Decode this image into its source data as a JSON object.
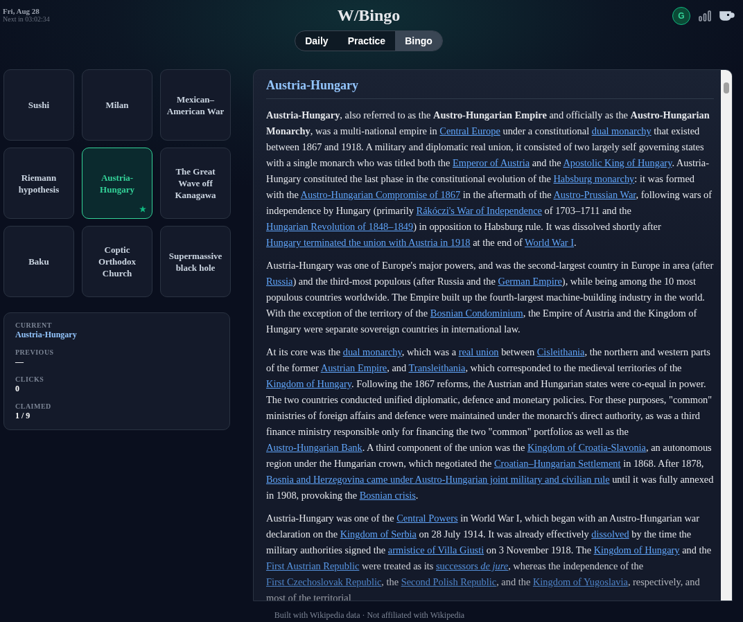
{
  "header": {
    "date": "Fri, Aug 28",
    "countdown": "Next in 03:02:34",
    "title": "W/Bingo",
    "avatar": "G"
  },
  "tabs": [
    {
      "label": "Daily",
      "selected": false
    },
    {
      "label": "Practice",
      "selected": false
    },
    {
      "label": "Bingo",
      "selected": true
    }
  ],
  "tiles": [
    {
      "label": "Sushi",
      "selected": false,
      "claimed": false
    },
    {
      "label": "Milan",
      "selected": false,
      "claimed": false
    },
    {
      "label": "Mexican–American War",
      "selected": false,
      "claimed": false
    },
    {
      "label": "Riemann hypothesis",
      "selected": false,
      "claimed": false
    },
    {
      "label": "Austria-Hungary",
      "selected": true,
      "claimed": true
    },
    {
      "label": "The Great Wave off Kanagawa",
      "selected": false,
      "claimed": false
    },
    {
      "label": "Baku",
      "selected": false,
      "claimed": false
    },
    {
      "label": "Coptic Orthodox Church",
      "selected": false,
      "claimed": false
    },
    {
      "label": "Supermassive black hole",
      "selected": false,
      "claimed": false
    }
  ],
  "stats": [
    {
      "label": "CURRENT",
      "value": "Austria-Hungary",
      "accent": true
    },
    {
      "label": "PREVIOUS",
      "value": "—",
      "accent": false
    },
    {
      "label": "CLICKS",
      "value": "0",
      "accent": false
    },
    {
      "label": "CLAIMED",
      "value": "1 / 9",
      "accent": false
    }
  ],
  "article": {
    "title": "Austria-Hungary",
    "paragraphs": [
      [
        {
          "text": "**Austria-Hungary**, also referred to as the **Austro-Hungarian Empire** and officially as the **Austro-Hungarian Monarchy**, was a multi-national empire in ",
          "kind": "text"
        },
        {
          "text": "Central Europe",
          "kind": "link"
        },
        {
          "text": " under a constitutional ",
          "kind": "text"
        },
        {
          "text": "dual monarchy",
          "kind": "link"
        },
        {
          "text": " that existed between 1867 and 1918. A military and diplomatic real union, it consisted of two largely self governing states with a single monarch who was titled both the ",
          "kind": "text"
        },
        {
          "text": "Emperor of Austria",
          "kind": "link"
        },
        {
          "text": " and the ",
          "kind": "text"
        },
        {
          "text": "Apostolic King of Hungary",
          "kind": "link"
        },
        {
          "text": ". Austria-Hungary constituted the last phase in the constitutional evolution of the ",
          "kind": "text"
        },
        {
          "text": "Habsburg monarchy",
          "kind": "link"
        },
        {
          "text": ": it was formed with the ",
          "kind": "text"
        },
        {
          "text": "Austro-Hungarian Compromise of 1867",
          "kind": "link"
        },
        {
          "text": " in the aftermath of the ",
          "kind": "text"
        },
        {
          "text": "Austro-Prussian War",
          "kind": "link"
        },
        {
          "text": ", following wars of independence by Hungary (primarily ",
          "kind": "text"
        },
        {
          "text": "Rákóczi's War of Independence",
          "kind": "link"
        },
        {
          "text": " of 1703–1711 and the ",
          "kind": "text"
        },
        {
          "text": "Hungarian Revolution of 1848–1849",
          "kind": "link"
        },
        {
          "text": ") in opposition to Habsburg rule. It was dissolved shortly after ",
          "kind": "text"
        },
        {
          "text": "Hungary terminated the union with Austria in 1918",
          "kind": "link"
        },
        {
          "text": " at the end of ",
          "kind": "text"
        },
        {
          "text": "World War I",
          "kind": "link"
        },
        {
          "text": ".",
          "kind": "text"
        }
      ],
      [
        {
          "text": "Austria-Hungary was one of Europe's major powers, and was the second-largest country in Europe in area (after ",
          "kind": "text"
        },
        {
          "text": "Russia",
          "kind": "link"
        },
        {
          "text": ") and the third-most populous (after Russia and the ",
          "kind": "text"
        },
        {
          "text": "German Empire",
          "kind": "link"
        },
        {
          "text": "), while being among the 10 most populous countries worldwide. The Empire built up the fourth-largest machine-building industry in the world. With the exception of the territory of the ",
          "kind": "text"
        },
        {
          "text": "Bosnian Condominium",
          "kind": "link"
        },
        {
          "text": ", the Empire of Austria and the Kingdom of Hungary were separate sovereign countries in international law.",
          "kind": "text"
        }
      ],
      [
        {
          "text": "At its core was the ",
          "kind": "text"
        },
        {
          "text": "dual monarchy",
          "kind": "link"
        },
        {
          "text": ", which was a ",
          "kind": "text"
        },
        {
          "text": "real union",
          "kind": "link"
        },
        {
          "text": " between ",
          "kind": "text"
        },
        {
          "text": "Cisleithania",
          "kind": "link"
        },
        {
          "text": ", the northern and western parts of the former ",
          "kind": "text"
        },
        {
          "text": "Austrian Empire",
          "kind": "link"
        },
        {
          "text": ", and ",
          "kind": "text"
        },
        {
          "text": "Transleithania",
          "kind": "link"
        },
        {
          "text": ", which corresponded to the medieval territories of the ",
          "kind": "text"
        },
        {
          "text": "Kingdom of Hungary",
          "kind": "link"
        },
        {
          "text": ". Following the 1867 reforms, the Austrian and Hungarian states were co-equal in power. The two countries conducted unified diplomatic, defence and monetary policies. For these purposes, \"common\" ministries of foreign affairs and defence were maintained under the monarch's direct authority, as was a third finance ministry responsible only for financing the two \"common\" portfolios as well as the ",
          "kind": "text"
        },
        {
          "text": "Austro-Hungarian Bank",
          "kind": "link"
        },
        {
          "text": ". A third component of the union was the ",
          "kind": "text"
        },
        {
          "text": "Kingdom of Croatia-Slavonia",
          "kind": "link"
        },
        {
          "text": ", an autonomous region under the Hungarian crown, which negotiated the ",
          "kind": "text"
        },
        {
          "text": "Croatian–Hungarian Settlement",
          "kind": "link"
        },
        {
          "text": " in 1868. After 1878, ",
          "kind": "text"
        },
        {
          "text": "Bosnia and Herzegovina came under Austro-Hungarian joint military and civilian rule",
          "kind": "link"
        },
        {
          "text": " until it was fully annexed in 1908, provoking the ",
          "kind": "text"
        },
        {
          "text": "Bosnian crisis",
          "kind": "link"
        },
        {
          "text": ".",
          "kind": "text"
        }
      ],
      [
        {
          "text": "Austria-Hungary was one of the ",
          "kind": "text"
        },
        {
          "text": "Central Powers",
          "kind": "link"
        },
        {
          "text": " in World War I, which began with an Austro-Hungarian war declaration on the ",
          "kind": "text"
        },
        {
          "text": "Kingdom of Serbia",
          "kind": "link"
        },
        {
          "text": " on 28 July 1914. It was already effectively ",
          "kind": "text"
        },
        {
          "text": "dissolved",
          "kind": "link"
        },
        {
          "text": " by the time the military authorities signed the ",
          "kind": "text"
        },
        {
          "text": "armistice of Villa Giusti",
          "kind": "link"
        },
        {
          "text": " on 3 November 1918. The ",
          "kind": "text"
        },
        {
          "text": "Kingdom of Hungary",
          "kind": "link"
        },
        {
          "text": " and the ",
          "kind": "text"
        },
        {
          "text": "First Austrian Republic",
          "kind": "link"
        },
        {
          "text": " were treated as its ",
          "kind": "text"
        },
        {
          "text": "successors *de jure*",
          "kind": "link"
        },
        {
          "text": ", whereas the independence of the ",
          "kind": "text"
        },
        {
          "text": "First Czechoslovak Republic",
          "kind": "link"
        },
        {
          "text": ", the ",
          "kind": "text"
        },
        {
          "text": "Second Polish Republic",
          "kind": "link"
        },
        {
          "text": ", and the ",
          "kind": "text"
        },
        {
          "text": "Kingdom of Yugoslavia",
          "kind": "link"
        },
        {
          "text": ", respectively, and most of the territorial",
          "kind": "text"
        }
      ]
    ]
  },
  "footer": "Built with Wikipedia data · Not affiliated with Wikipedia"
}
